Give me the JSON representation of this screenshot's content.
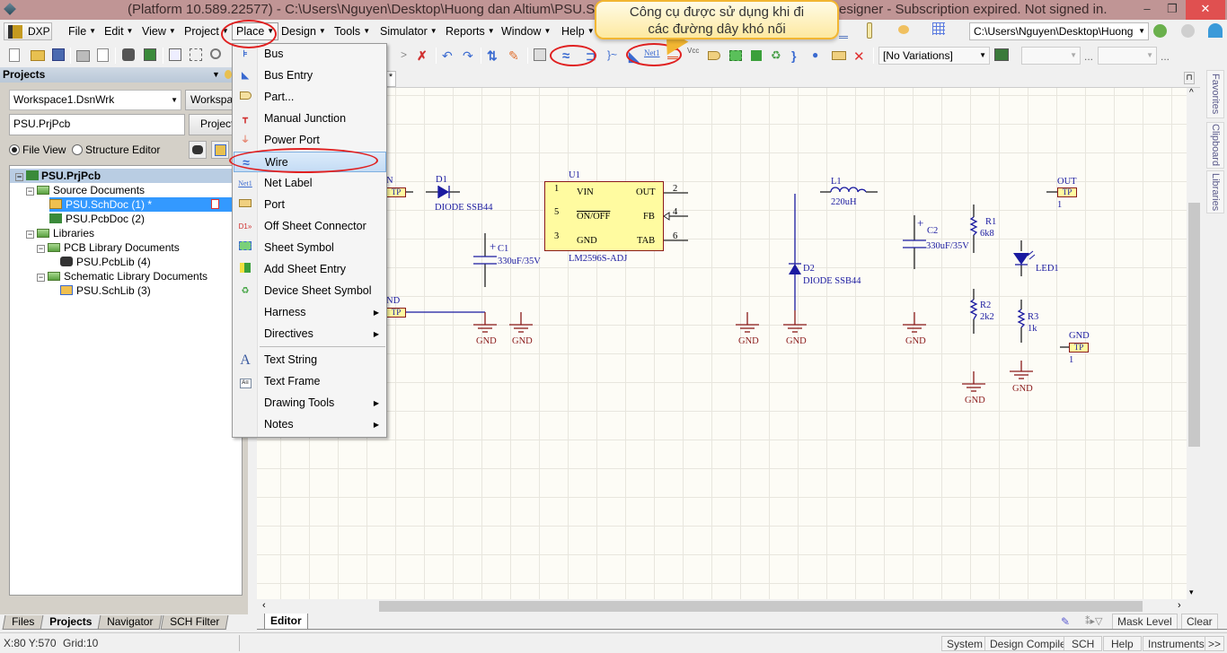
{
  "window": {
    "title": "(Platform 10.589.22577) - C:\\Users\\Nguyen\\Desktop\\Huong dan Altium\\PSU.SchDoc - Altium Designer - Subscription expired. Not signed in.",
    "title_visible_left": "(Platform 10.589.22577) - C:\\Users\\Nguyen\\Desktop\\Huong dan Altium\\PSU.Sc",
    "title_visible_right": "esigner - Subscription expired. Not signed in.",
    "controls": {
      "minimize": "–",
      "restore": "❐",
      "close": "✕"
    }
  },
  "menubar": {
    "dxp_label": "DXP",
    "items": [
      {
        "label": "File"
      },
      {
        "label": "Edit"
      },
      {
        "label": "View"
      },
      {
        "label": "Project"
      },
      {
        "label": "Place"
      },
      {
        "label": "Design"
      },
      {
        "label": "Tools"
      },
      {
        "label": "Simulator"
      },
      {
        "label": "Reports"
      },
      {
        "label": "Window"
      },
      {
        "label": "Help"
      }
    ],
    "path_combo": "C:\\Users\\Nguyen\\Desktop\\Huong"
  },
  "toolbar": {
    "variations_combo": "[No Variations]",
    "ellipsis": "..."
  },
  "callout": {
    "line1": "Công cụ được sử dụng khi đi",
    "line2": "các đường dây khó nối",
    "accent": "#f2b632"
  },
  "projects_panel": {
    "title": "Projects",
    "workspace_combo": "Workspace1.DsnWrk",
    "workspace_button": "Workspace",
    "project_field": "PSU.PrjPcb",
    "project_button": "Project",
    "radio_file_view": "File View",
    "radio_structure_editor": "Structure Editor",
    "selected_view": "File View",
    "tree": [
      {
        "label": "PSU.PrjPcb",
        "level": 0
      },
      {
        "label": "Source Documents",
        "level": 1
      },
      {
        "label": "PSU.SchDoc (1) *",
        "level": 2,
        "selected": true
      },
      {
        "label": "PSU.PcbDoc (2)",
        "level": 2
      },
      {
        "label": "Libraries",
        "level": 1
      },
      {
        "label": "PCB Library Documents",
        "level": 2
      },
      {
        "label": "PSU.PcbLib (4)",
        "level": 3
      },
      {
        "label": "Schematic Library Documents",
        "level": 2
      },
      {
        "label": "PSU.SchLib (3)",
        "level": 3
      }
    ],
    "bottom_tabs": [
      {
        "label": "Files"
      },
      {
        "label": "Projects",
        "active": true
      },
      {
        "label": "Navigator"
      },
      {
        "label": "SCH Filter"
      }
    ]
  },
  "place_menu": {
    "items": [
      {
        "label": "Bus",
        "icon": "bus-icon"
      },
      {
        "label": "Bus Entry",
        "icon": "bus-entry-icon"
      },
      {
        "label": "Part...",
        "icon": "part-icon"
      },
      {
        "label": "Manual Junction",
        "icon": "junction-icon"
      },
      {
        "label": "Power Port",
        "icon": "power-port-icon"
      },
      {
        "label": "Wire",
        "icon": "wire-icon",
        "highlighted": true
      },
      {
        "label": "Net Label",
        "icon": "net-label-icon"
      },
      {
        "label": "Port",
        "icon": "port-icon"
      },
      {
        "label": "Off Sheet Connector",
        "icon": "off-sheet-connector-icon"
      },
      {
        "label": "Sheet Symbol",
        "icon": "sheet-symbol-icon"
      },
      {
        "label": "Add Sheet Entry",
        "icon": "sheet-entry-icon"
      },
      {
        "label": "Device Sheet Symbol",
        "icon": "device-sheet-icon"
      },
      {
        "label": "Harness",
        "submenu": true
      },
      {
        "label": "Directives",
        "submenu": true
      },
      {
        "label": "Text String",
        "icon": "text-string-icon"
      },
      {
        "label": "Text Frame",
        "icon": "text-frame-icon"
      },
      {
        "label": "Drawing Tools",
        "submenu": true
      },
      {
        "label": "Notes",
        "submenu": true
      }
    ]
  },
  "document_tab": {
    "label": "*"
  },
  "right_dock": {
    "tabs": [
      "Favorites",
      "Clipboard",
      "Libraries"
    ]
  },
  "editor_tab": {
    "label": "Editor"
  },
  "mask_bar": {
    "mask_level": "Mask Level",
    "clear": "Clear"
  },
  "status_bar": {
    "coords": "X:80 Y:570",
    "grid": "Grid:10",
    "buttons": [
      "System",
      "Design Compiler",
      "SCH",
      "Help",
      "Instruments"
    ],
    "more": ">>"
  },
  "schematic": {
    "colors": {
      "wire": "#1a1aa0",
      "component": "#8a1a1a",
      "fill": "#fffba0",
      "sheet": "#fdfcf6"
    },
    "labels": {
      "tp_in_net": "N",
      "tp_gnd_net": "ND",
      "tp": "TP",
      "d1_ref": "D1",
      "d1_val": "DIODE SSB44",
      "c1_ref": "C1",
      "c1_val": "330uF/35V",
      "u1_ref": "U1",
      "u1_val": "LM2596S-ADJ",
      "u1_pins_left": [
        {
          "num": "1",
          "name": "VIN"
        },
        {
          "num": "5",
          "name": "ON/OFF"
        },
        {
          "num": "3",
          "name": "GND"
        }
      ],
      "u1_pins_right": [
        {
          "num": "2",
          "name": "OUT"
        },
        {
          "num": "4",
          "name": "FB"
        },
        {
          "num": "6",
          "name": "TAB"
        }
      ],
      "l1_ref": "L1",
      "l1_val": "220uH",
      "d2_ref": "D2",
      "d2_val": "DIODE SSB44",
      "c2_ref": "C2",
      "c2_val": "330uF/35V",
      "r1_ref": "R1",
      "r1_val": "6k8",
      "r2_ref": "R2",
      "r2_val": "2k2",
      "r3_ref": "R3",
      "r3_val": "1k",
      "led_ref": "LED1",
      "out_net": "OUT",
      "gnd_net": "GND",
      "pin1": "1",
      "gnd": "GND",
      "plus": "+"
    }
  }
}
